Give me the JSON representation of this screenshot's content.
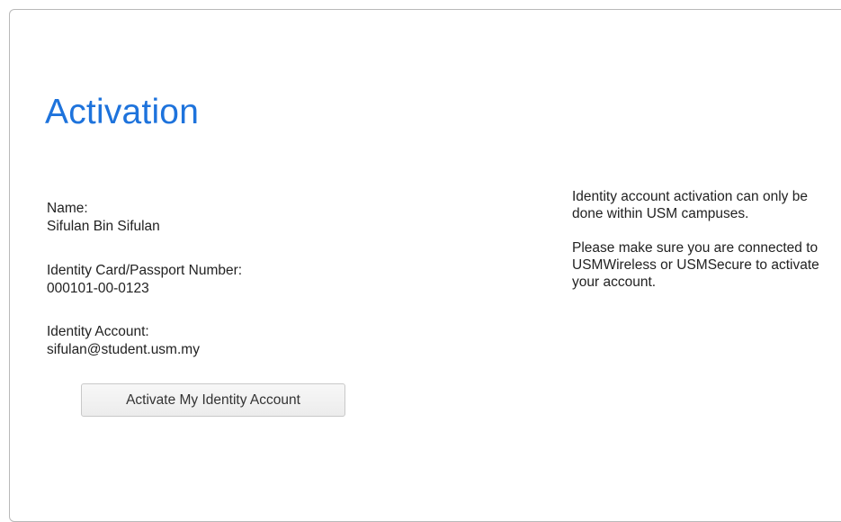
{
  "page": {
    "title": "Activation"
  },
  "details": {
    "name_label": "Name:",
    "name_value": "Sifulan Bin Sifulan",
    "ic_label": "Identity Card/Passport Number:",
    "ic_value": "000101-00-0123",
    "account_label": "Identity Account:",
    "account_value": "sifulan@student.usm.my"
  },
  "actions": {
    "activate_label": "Activate My Identity Account"
  },
  "notice": {
    "paragraph_1": "Identity account activation can only be done within USM campuses.",
    "paragraph_2": "Please make sure you are connected to USMWireless or USMSecure to activate your account."
  },
  "colors": {
    "title": "#1e73dc",
    "panel_border": "#b9b9b9",
    "button_border": "#c8c8c8"
  }
}
